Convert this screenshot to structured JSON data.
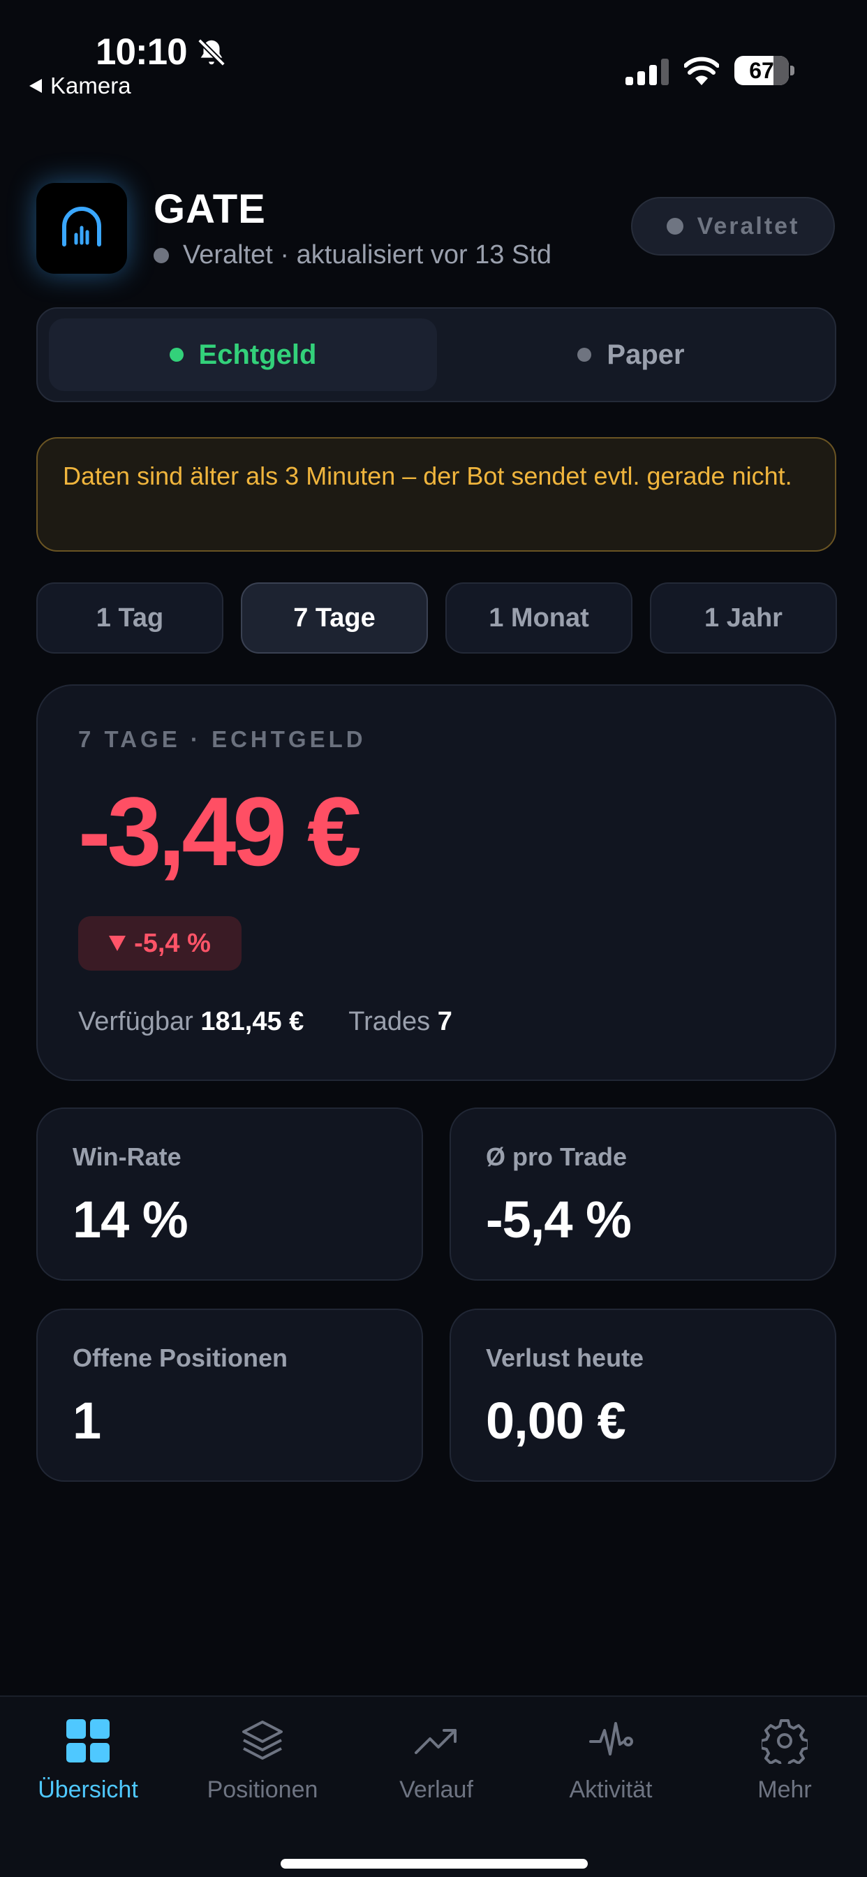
{
  "status_bar": {
    "time": "10:10",
    "back_label": "Kamera",
    "battery": "67"
  },
  "header": {
    "title": "GATE",
    "status_text": "Veraltet · aktualisiert vor 13 Std",
    "badge": "Veraltet"
  },
  "mode_toggle": {
    "options": [
      {
        "label": "Echtgeld",
        "selected": true
      },
      {
        "label": "Paper",
        "selected": false
      }
    ]
  },
  "warning": {
    "text": "Daten sind älter als 3 Minuten – der Bot sendet evtl. gerade nicht."
  },
  "range_tabs": [
    {
      "label": "1 Tag",
      "selected": false
    },
    {
      "label": "7 Tage",
      "selected": true
    },
    {
      "label": "1 Monat",
      "selected": false
    },
    {
      "label": "1 Jahr",
      "selected": false
    }
  ],
  "summary": {
    "label": "7 TAGE · ECHTGELD",
    "value": "-3,49 €",
    "change": "-5,4 %",
    "available_label": "Verfügbar",
    "available_value": "181,45 €",
    "trades_label": "Trades",
    "trades_value": "7"
  },
  "stats": [
    {
      "label": "Win-Rate",
      "value": "14 %"
    },
    {
      "label": "Ø pro Trade",
      "value": "-5,4 %"
    },
    {
      "label": "Offene Positionen",
      "value": "1"
    },
    {
      "label": "Verlust heute",
      "value": "0,00 €"
    }
  ],
  "tabbar": {
    "items": [
      {
        "label": "Übersicht",
        "icon": "grid-icon",
        "active": true
      },
      {
        "label": "Positionen",
        "icon": "layers-icon",
        "active": false
      },
      {
        "label": "Verlauf",
        "icon": "trend-up-icon",
        "active": false
      },
      {
        "label": "Aktivität",
        "icon": "pulse-icon",
        "active": false
      },
      {
        "label": "Mehr",
        "icon": "gear-icon",
        "active": false
      }
    ]
  },
  "colors": {
    "accent_blue": "#4fc8ff",
    "loss_red": "#ff4f64",
    "live_green": "#33d17a",
    "warning_amber": "#f0b53d"
  }
}
